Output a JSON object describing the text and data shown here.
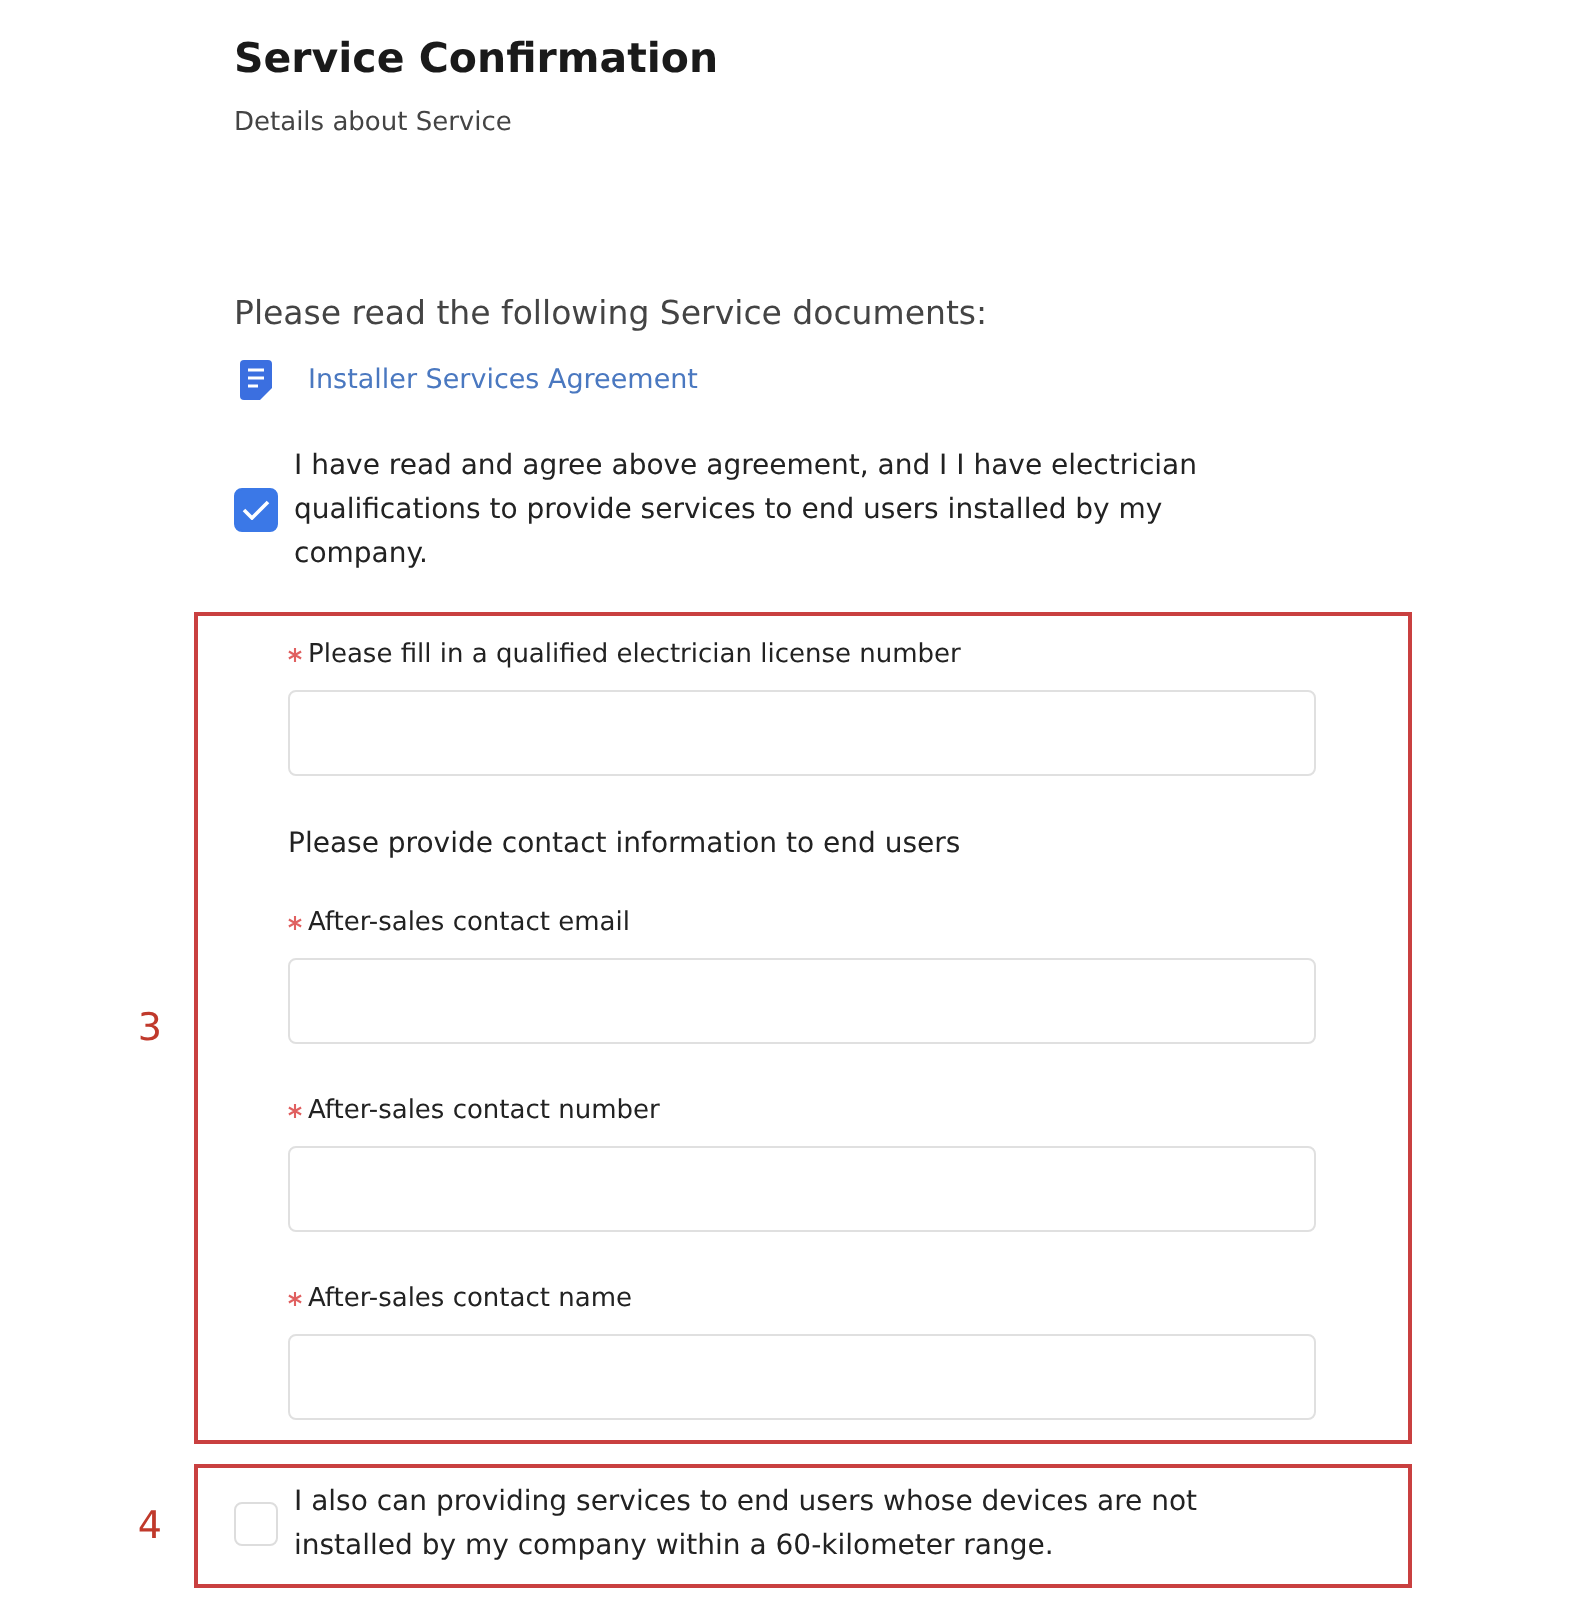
{
  "header": {
    "title": "Service Confirmation",
    "subtitle": "Details about Service"
  },
  "documents": {
    "heading": "Please read the following Service documents:",
    "items": [
      {
        "label": "Installer Services Agreement"
      }
    ]
  },
  "agreement": {
    "checked": true,
    "text": "I have read and agree above agreement, and I I have electrician qualifications to provide services to end users installed by my company."
  },
  "annotations": [
    {
      "number": "3",
      "items": [
        {
          "kind": "field",
          "label": "Please fill in a qualified electrician license number",
          "required": true
        },
        {
          "kind": "heading",
          "text": "Please provide contact information to end users"
        },
        {
          "kind": "field",
          "label": "After-sales contact email",
          "required": true
        },
        {
          "kind": "field",
          "label": "After-sales contact number",
          "required": true
        },
        {
          "kind": "field",
          "label": "After-sales contact name",
          "required": true
        }
      ]
    },
    {
      "number": "4",
      "items": [
        {
          "kind": "checkbox",
          "checked": false,
          "text": "I also can providing services to end users whose devices are not installed by my company within a 60-kilometer range."
        }
      ]
    }
  ]
}
